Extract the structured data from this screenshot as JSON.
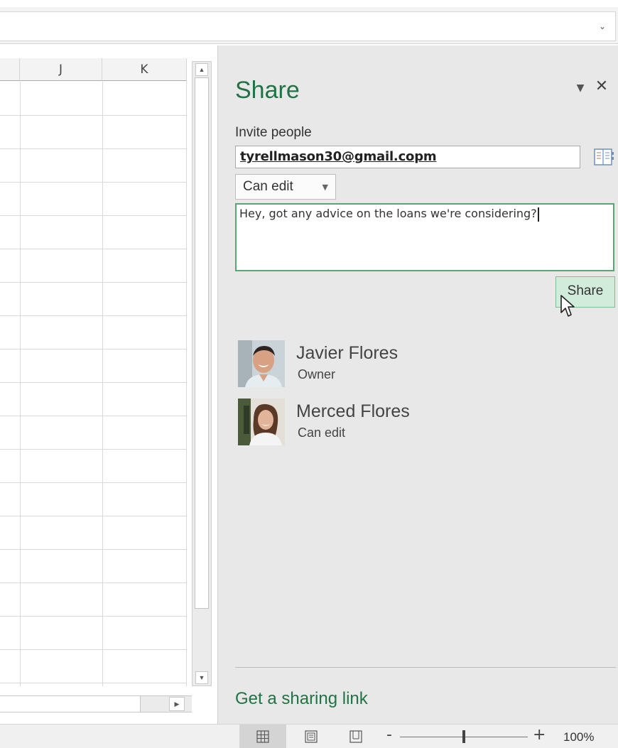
{
  "grid": {
    "columns": [
      "J",
      "K"
    ]
  },
  "share_pane": {
    "title": "Share",
    "invite_label": "Invite people",
    "invite_value": "tyrellmason30@gmail.copm",
    "permission_selected": "Can edit",
    "message_value": "Hey, got any advice on the loans we're considering?",
    "share_button_label": "Share",
    "people": [
      {
        "name": "Javier Flores",
        "role": "Owner",
        "avatar": "person-photo-icon"
      },
      {
        "name": "Merced Flores",
        "role": "Can edit",
        "avatar": "person-photo-icon"
      }
    ],
    "sharing_link_label": "Get a sharing link",
    "accent_color": "#217346"
  },
  "statusbar": {
    "zoom_level": "100%",
    "views": [
      "normal-view-icon",
      "page-layout-icon",
      "page-break-preview-icon"
    ]
  }
}
